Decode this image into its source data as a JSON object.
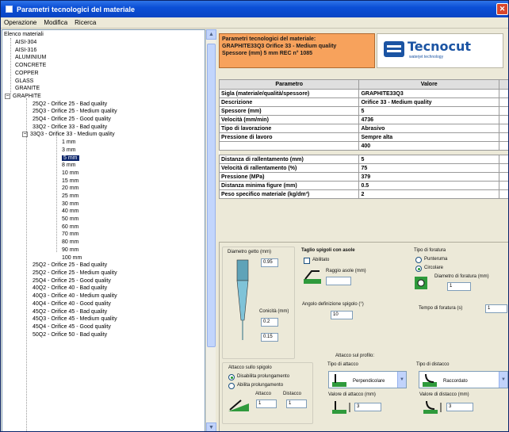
{
  "window": {
    "title": "Parametri tecnologici del materiale",
    "close_symbol": "✕"
  },
  "menu": [
    "Operazione",
    "Modifica",
    "Ricerca"
  ],
  "tree": {
    "root": "Elenco materiali",
    "items": [
      {
        "label": "AISI-304",
        "level": 1
      },
      {
        "label": "AISI-316",
        "level": 1
      },
      {
        "label": "ALUMINIUM",
        "level": 1
      },
      {
        "label": "CONCRETE",
        "level": 1
      },
      {
        "label": "COPPER",
        "level": 1
      },
      {
        "label": "GLASS",
        "level": 1
      },
      {
        "label": "GRANITE",
        "level": 1
      },
      {
        "label": "GRAPHITE",
        "level": 1,
        "expander": "−"
      },
      {
        "label": "25Q2 - Orifice 25 - Bad quality",
        "level": 2
      },
      {
        "label": "25Q3 - Orifice 25 - Medium quality",
        "level": 2
      },
      {
        "label": "25Q4 - Orifice 25 - Good quality",
        "level": 2
      },
      {
        "label": "33Q2 - Orifice 33 - Bad quality",
        "level": 2
      },
      {
        "label": "33Q3 - Orifice 33 - Medium quality",
        "level": 2,
        "expander": "−"
      },
      {
        "label": "1 mm",
        "level": 3
      },
      {
        "label": "3 mm",
        "level": 3
      },
      {
        "label": "5 mm",
        "level": 3,
        "selected": true
      },
      {
        "label": "8 mm",
        "level": 3
      },
      {
        "label": "10 mm",
        "level": 3
      },
      {
        "label": "15 mm",
        "level": 3
      },
      {
        "label": "20 mm",
        "level": 3
      },
      {
        "label": "25 mm",
        "level": 3
      },
      {
        "label": "30 mm",
        "level": 3
      },
      {
        "label": "40 mm",
        "level": 3
      },
      {
        "label": "50 mm",
        "level": 3
      },
      {
        "label": "60 mm",
        "level": 3
      },
      {
        "label": "70 mm",
        "level": 3
      },
      {
        "label": "80 mm",
        "level": 3
      },
      {
        "label": "90 mm",
        "level": 3
      },
      {
        "label": "100 mm",
        "level": 3
      },
      {
        "label": "25Q2 - Orifice 25 - Bad quality",
        "level": 2
      },
      {
        "label": "25Q2 - Orifice 25 - Medium quality",
        "level": 2
      },
      {
        "label": "25Q4 - Orifice 25 - Good quality",
        "level": 2
      },
      {
        "label": "40Q2 - Orifice 40 - Bad quality",
        "level": 2
      },
      {
        "label": "40Q3 - Orifice 40 - Medium quality",
        "level": 2
      },
      {
        "label": "40Q4 - Orifice 40 - Good quality",
        "level": 2
      },
      {
        "label": "45Q2 - Orifice 45 - Bad quality",
        "level": 2
      },
      {
        "label": "45Q3 - Orifice 45 - Medium quality",
        "level": 2
      },
      {
        "label": "45Q4 - Orifice 45 - Good quality",
        "level": 2
      },
      {
        "label": "50Q2 - Orifice 50 - Bad quality",
        "level": 2
      }
    ]
  },
  "scrollbar": {
    "up": "▲",
    "down": "▼"
  },
  "info": {
    "line1": "Parametri tecnologici del materiale:",
    "line2": "GRAPHITE33Q3  Orifice 33 - Medium quality",
    "line3": "Spessore (mm) 5 mm     REC n° 1085"
  },
  "logo": {
    "name": "Tecnocut",
    "sub": "waterjet technology"
  },
  "table": {
    "headers": [
      "Parametro",
      "Valore",
      ""
    ],
    "rows": [
      [
        "Sigla (materiale/qualità/spessore)",
        "GRAPHITE33Q3"
      ],
      [
        "Descrizione",
        "Orifice 33 - Medium quality"
      ],
      [
        "Spessore (mm)",
        "5"
      ],
      [
        "Velocità (mm/min)",
        "4736"
      ],
      [
        "Tipo di lavorazione",
        "Abrasivo"
      ],
      [
        "Pressione di lavoro",
        "Sempre alta"
      ],
      [
        "",
        "400"
      ],
      null,
      [
        "Distanza di rallentamento (mm)",
        "5"
      ],
      [
        "Velocità di rallentamento (%)",
        "75"
      ],
      [
        "Pressione (MPa)",
        "379"
      ],
      [
        "Distanza minima figure (mm)",
        "0.5"
      ],
      [
        "Peso specifico materiale (kg/dm³)",
        "2"
      ]
    ]
  },
  "config": {
    "nozzle": {
      "label_diam": "Diametro getto (mm)",
      "diam_value": "0.95",
      "label_conicity": "Conicità (mm)",
      "conicity_value": "0.2",
      "extra_value": "0.15"
    },
    "corner": {
      "title": "Taglio spigoli con asole",
      "enable_label": "Abilitato",
      "radius_label": "Raggio asole (mm)",
      "radius_value": "",
      "angle_label": "Angolo definizione spigolo (°)",
      "angle_value": "10"
    },
    "tool": {
      "title": "Tipo di foratura",
      "opt1": "Punteruma",
      "opt2": "Circolare",
      "diam_label": "Diametro di foratura (mm)",
      "diam_value": "1",
      "time_label": "Tempo di foratura (s)",
      "time_value": "1"
    },
    "edge": {
      "title": "Attacco sullo spigolo",
      "opt1": "Disabilita prolungamento",
      "opt2": "Abilita prolungamento",
      "attack_label": "Attacco",
      "distance_label": "Distacco",
      "attack_value": "1",
      "distance_value": "1"
    },
    "profile": {
      "title": "Attacco sul profilo:",
      "attack_type_label": "Tipo di attacco",
      "attack_type_value": "Perpendicolare",
      "distance_type_label": "Tipo di distacco",
      "distance_type_value": "Raccordato",
      "attack_value_label": "Valore di attacco (mm)",
      "attack_value": "3",
      "distance_value_label": "Valore di distacco (mm)",
      "distance_value": "3"
    }
  },
  "colors": {
    "titlebar": "#0b4fd6",
    "info_bg": "#f7a25c",
    "logo_blue": "#1b54a3",
    "selection": "#0a246a"
  }
}
